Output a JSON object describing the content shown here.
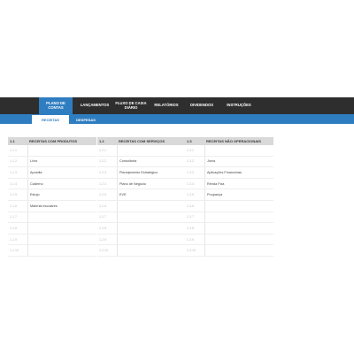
{
  "nav": {
    "items": [
      {
        "label": "PLANO DE CONTAS",
        "active": true
      },
      {
        "label": "LANÇAMENTOS",
        "active": false
      },
      {
        "label": "FLUXO DE CAIXA DIÁRIO",
        "active": false
      },
      {
        "label": "RELATÓRIOS",
        "active": false
      },
      {
        "label": "DIVIDENDOS",
        "active": false
      },
      {
        "label": "INSTRUÇÕES",
        "active": false
      }
    ]
  },
  "subtabs": [
    {
      "label": "RECEITAS",
      "active": true
    },
    {
      "label": "DESPESAS",
      "active": false
    }
  ],
  "tables": [
    {
      "code": "1.1",
      "title": "RECEITAS COM PRODUTOS",
      "rows": [
        {
          "code": "1.1.1",
          "label": ""
        },
        {
          "code": "1.1.2",
          "label": "Livro"
        },
        {
          "code": "1.1.3",
          "label": "Apostila"
        },
        {
          "code": "1.1.4",
          "label": "Caderno"
        },
        {
          "code": "1.1.5",
          "label": "Estojo"
        },
        {
          "code": "1.1.6",
          "label": "Material escolares"
        },
        {
          "code": "1.1.7",
          "label": ""
        },
        {
          "code": "1.1.8",
          "label": ""
        },
        {
          "code": "1.1.9",
          "label": ""
        },
        {
          "code": "1.1.10",
          "label": ""
        }
      ]
    },
    {
      "code": "1.2",
      "title": "RECEITAS COM SERVIÇOS",
      "rows": [
        {
          "code": "1.2.1",
          "label": ""
        },
        {
          "code": "1.2.2",
          "label": "Consultoria"
        },
        {
          "code": "1.2.3",
          "label": "Planejamento Estratégico"
        },
        {
          "code": "1.2.4",
          "label": "Plano de Negócio"
        },
        {
          "code": "1.2.5",
          "label": "EVE"
        },
        {
          "code": "1.2.6",
          "label": ""
        },
        {
          "code": "1.2.7",
          "label": ""
        },
        {
          "code": "1.2.8",
          "label": ""
        },
        {
          "code": "1.2.9",
          "label": ""
        },
        {
          "code": "1.2.10",
          "label": ""
        }
      ]
    },
    {
      "code": "1.3",
      "title": "RECEITAS NÃO OPERACIONAIS",
      "rows": [
        {
          "code": "1.3.1",
          "label": ""
        },
        {
          "code": "1.3.2",
          "label": "Juros"
        },
        {
          "code": "1.3.3",
          "label": "Aplicações Financeiras"
        },
        {
          "code": "1.3.4",
          "label": "Renda Fixa"
        },
        {
          "code": "1.3.5",
          "label": "Poupança"
        },
        {
          "code": "1.3.6",
          "label": ""
        },
        {
          "code": "1.3.7",
          "label": ""
        },
        {
          "code": "1.3.8",
          "label": ""
        },
        {
          "code": "1.3.9",
          "label": ""
        },
        {
          "code": "1.3.10",
          "label": ""
        }
      ]
    }
  ]
}
